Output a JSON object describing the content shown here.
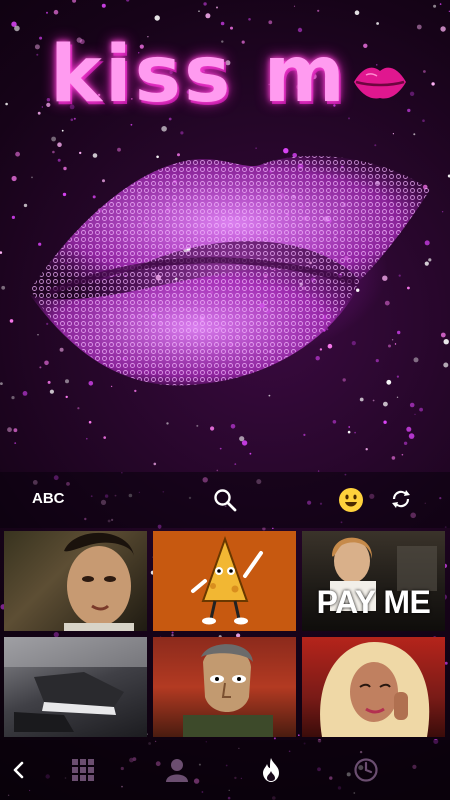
{
  "theme": {
    "title": "kiss m",
    "accent": "#ff5ad9"
  },
  "toolbar": {
    "abc_label": "ABC",
    "icons": [
      "search-icon",
      "emoji-icon",
      "refresh-icon"
    ]
  },
  "gifs": {
    "items": [
      {
        "id": "gif-woman-crying"
      },
      {
        "id": "gif-cartoon-cheese-waving"
      },
      {
        "id": "gif-pay-me",
        "caption": "PAY ME"
      },
      {
        "id": "gif-sneakers"
      },
      {
        "id": "gif-cartoon-man"
      },
      {
        "id": "gif-blonde-woman"
      }
    ]
  },
  "bottom_nav": {
    "icons": [
      "back-icon",
      "grid-icon",
      "sticker-icon",
      "trending-fire-icon",
      "recent-clock-icon"
    ]
  }
}
